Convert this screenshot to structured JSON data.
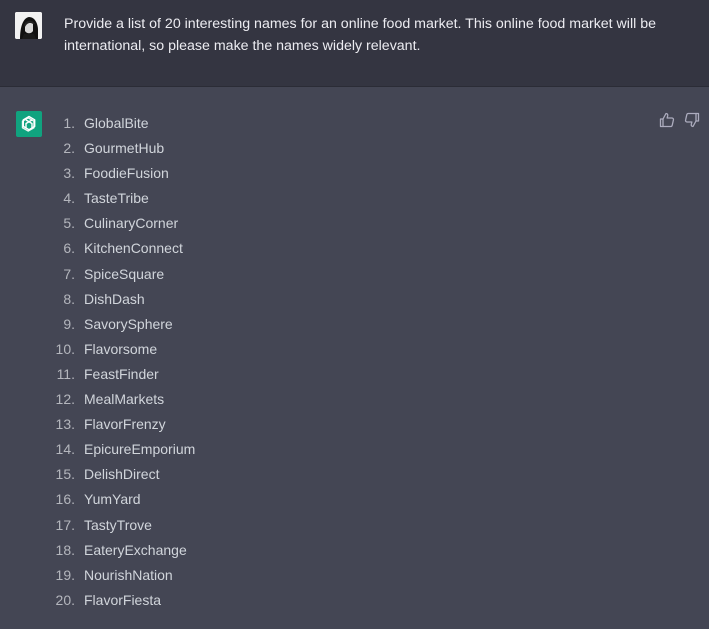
{
  "conversation": {
    "user_message": "Provide a list of 20 interesting names for an online food market. This online food market will be international, so please make the names widely relevant.",
    "assistant_list": [
      {
        "num": "1.",
        "name": "GlobalBite"
      },
      {
        "num": "2.",
        "name": "GourmetHub"
      },
      {
        "num": "3.",
        "name": "FoodieFusion"
      },
      {
        "num": "4.",
        "name": "TasteTribe"
      },
      {
        "num": "5.",
        "name": "CulinaryCorner"
      },
      {
        "num": "6.",
        "name": "KitchenConnect"
      },
      {
        "num": "7.",
        "name": "SpiceSquare"
      },
      {
        "num": "8.",
        "name": "DishDash"
      },
      {
        "num": "9.",
        "name": "SavorySphere"
      },
      {
        "num": "10.",
        "name": "Flavorsome"
      },
      {
        "num": "11.",
        "name": "FeastFinder"
      },
      {
        "num": "12.",
        "name": "MealMarkets"
      },
      {
        "num": "13.",
        "name": "FlavorFrenzy"
      },
      {
        "num": "14.",
        "name": "EpicureEmporium"
      },
      {
        "num": "15.",
        "name": "DelishDirect"
      },
      {
        "num": "16.",
        "name": "YumYard"
      },
      {
        "num": "17.",
        "name": "TastyTrove"
      },
      {
        "num": "18.",
        "name": "EateryExchange"
      },
      {
        "num": "19.",
        "name": "NourishNation"
      },
      {
        "num": "20.",
        "name": "FlavorFiesta"
      }
    ]
  },
  "icons": {
    "user_avatar": "user-avatar-image",
    "assistant_avatar": "openai-logo-icon",
    "like": "thumbs-up-icon",
    "dislike": "thumbs-down-icon"
  },
  "colors": {
    "user_row_bg": "#343541",
    "assistant_row_bg": "#444654",
    "assistant_avatar_bg": "#10a37f",
    "text": "#d1d5db"
  }
}
